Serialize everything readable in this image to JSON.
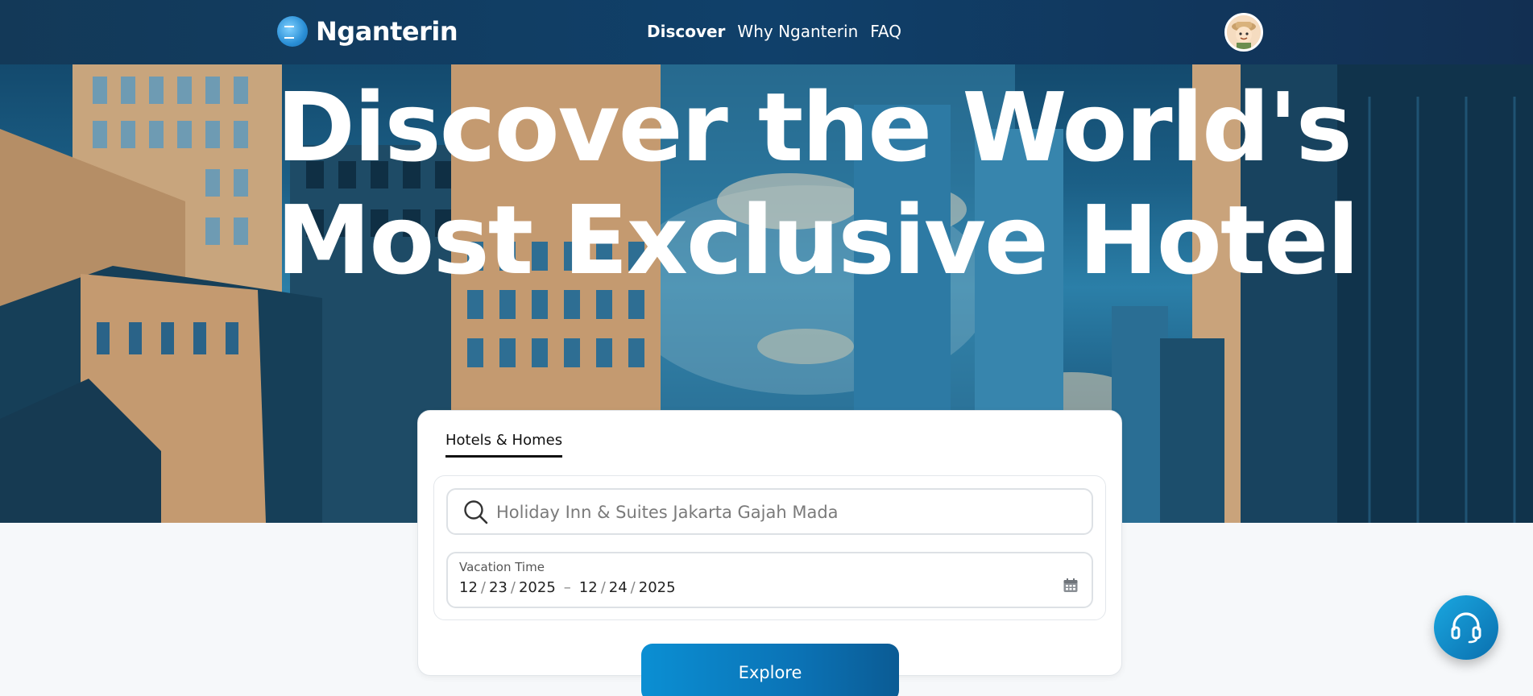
{
  "brand": {
    "name": "Nganterin"
  },
  "nav": {
    "items": [
      {
        "label": "Discover",
        "active": true
      },
      {
        "label": "Why Nganterin",
        "active": false
      },
      {
        "label": "FAQ",
        "active": false
      }
    ]
  },
  "hero": {
    "title_line1": "Discover the World's",
    "title_line2": "Most Exclusive Hotel"
  },
  "search_card": {
    "tab_label": "Hotels & Homes",
    "search": {
      "placeholder": "Holiday Inn & Suites Jakarta Gajah Mada",
      "icon": "search-icon"
    },
    "vacation": {
      "label": "Vacation Time",
      "start": {
        "month": "12",
        "day": "23",
        "year": "2025"
      },
      "end": {
        "month": "12",
        "day": "24",
        "year": "2025"
      },
      "dash": "–",
      "icon": "calendar-icon"
    },
    "explore_label": "Explore"
  },
  "support": {
    "icon": "headset-icon"
  },
  "colors": {
    "nav_bg": "#10406a",
    "accent": "#0b8fd3",
    "page_bg": "#f6f8fa"
  }
}
